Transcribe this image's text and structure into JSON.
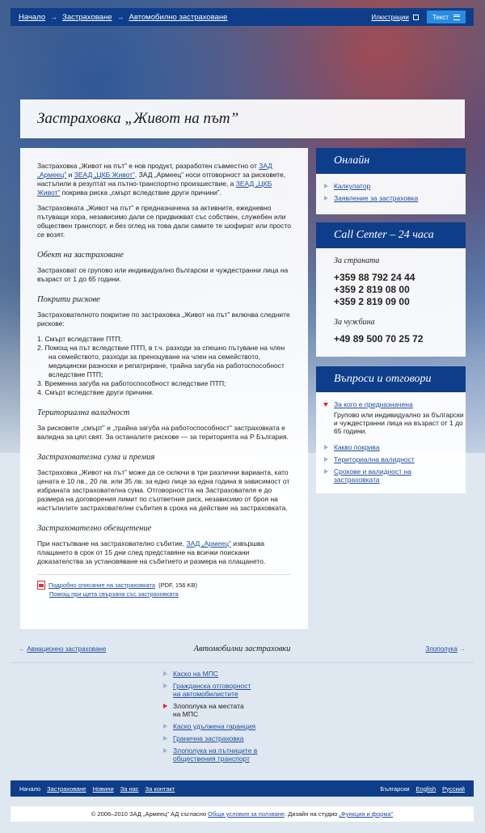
{
  "breadcrumbs": [
    "Начало",
    "Застраховане",
    "Автомобилно застраховане"
  ],
  "topbar": {
    "illustrations": "Илюстрации",
    "text_button": "Текст"
  },
  "page_title": "Застраховка „Живот на път”",
  "main": {
    "intro1_a": "Застраховка „Живот на път” е нов продукт, разработен съвместно от ",
    "intro1_link1": "ЗАД „Армеец”",
    "intro1_b": " и ",
    "intro1_link2": "ЗЕАД „ЦКБ Живот”",
    "intro1_c": ". ЗАД „Армеец” носи отговорност за рисковете, настъпили в резултат на пътно-транспортно произшествие, а ",
    "intro1_link3": "ЗЕАД „ЦКБ Живот”",
    "intro1_d": " покрива риска „смърт вследствие други причини”.",
    "intro2": "Застраховката „Живот на път” е предназначена за активните, ежедневно пътуващи хора, независимо дали се придвижват със собствен, служебен или обществен транспорт, и без оглед на това дали самите те шофират или просто се возят.",
    "h_object": "Обект на застраховане",
    "p_object": "Застраховат се групово или индивидуално български и чуждестранни лица на възраст от 1 до 65 години.",
    "h_risks": "Покрити рискове",
    "p_risks": "Застрахователното покритие по застраховка „Живот на път” включва следните рискове:",
    "risks": [
      "1. Смърт вследствие ПТП;",
      "2. Помощ на път вследствие ПТП, в т.ч. разходи за спешно пътуване на член на семейството, разходи за преноцуване на член на семейството, медицински разноски и репатриране, трайна загуба на работоспособност вследствие ПТП;",
      "3. Временна загуба на работоспособност вследствие ПТП;",
      "4. Смърт вследствие други причини."
    ],
    "h_territory": "Териториална валидност",
    "p_territory": "За рисковете „смърт” и „трайна загуба на работоспособност” застраховката е валидна за цял свят. За останалите рискове — за територията на Р България.",
    "h_sum": "Застрахователна сума и премия",
    "p_sum": "Застраховка „Живот на път” може  да се сключи в три различни варианта, като цената е 10 лв., 20 лв. или 35 лв. за едно лице за една година в зависимост от избраната застрахователна сума. Отговорността на Застрахователя е до размера на договорения лимит по съответния риск, независимо от броя на настъпилите застрахователни събития в срока на действие на застраховката.",
    "h_comp": "Застрахователно обезщетение",
    "p_comp_a": "При настъпване на застрахователно събитие, ",
    "p_comp_link": "ЗАД „Армеец”",
    "p_comp_b": " извършва плащането в срок от 15 дни след представяне на всички поискани доказателства за установяване на събитието и размера на плащането.",
    "doc_link": "Подробно описание на застраховката",
    "doc_meta": " (PDF, 156 KB)",
    "help_link": "Помощ при щета свързана със застраховката"
  },
  "online": {
    "title": "Онлайн",
    "items": [
      "Калкулатор",
      "Заявление за застраховка"
    ]
  },
  "callcenter": {
    "title": "Call Center – 24 часа",
    "domestic_label": "За страната",
    "domestic_numbers": [
      "+359 88 792 24 44",
      "+359 2 819 08 00",
      "+359 2 819 09 00"
    ],
    "abroad_label": "За чужбина",
    "abroad_number": "+49 89 500 70 25 72"
  },
  "faq": {
    "title": "Въпроси и отговори",
    "open_item": "За кого е предназначена",
    "open_answer": "Групово или индивидуално за български и чуждестранни лица на възраст от 1 до 65 години.",
    "items": [
      "Какво покрива",
      "Териториална валидност",
      "Срокове и валидност на застраховката"
    ]
  },
  "pager": {
    "prev": "Авиационно застраховане",
    "section": "Автомобилни застраховки",
    "next": "Злополука"
  },
  "section_items": [
    {
      "label": "Каско на МПС",
      "active": false
    },
    {
      "label": "Гражданска отговорност на автомобилистите",
      "active": false
    },
    {
      "label": "Злополука на местата на МПС",
      "active": true
    },
    {
      "label": "Каско удължена гаранция",
      "active": false
    },
    {
      "label": "Гранична застраховка",
      "active": false
    },
    {
      "label": "Злополука на пътниците в обществения транспорт",
      "active": false
    }
  ],
  "footer": {
    "links": [
      "Начало",
      "Застраховане",
      "Новини",
      "За нас",
      "За контакт"
    ],
    "lang_current": "Български",
    "langs": [
      "English",
      "Русский"
    ]
  },
  "copyright": {
    "a": "© 2006–2010 ЗАД „Армеец” АД съгласно ",
    "terms": "Общи условия за ползване",
    "b": ".  Дизайн на студио ",
    "studio": "„Функция и форма”"
  },
  "colors": {
    "brand": "#0e3e8a",
    "accent": "#2a8ce0",
    "active_marker": "#d22222"
  }
}
